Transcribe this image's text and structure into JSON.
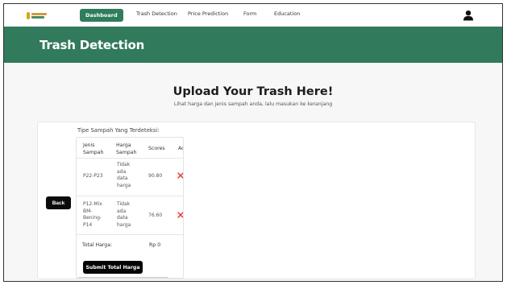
{
  "nav": {
    "items": [
      {
        "label": "Dashboard",
        "active": true
      },
      {
        "label": "Trash Detection",
        "active": false
      },
      {
        "label": "Price Prediction",
        "active": false
      },
      {
        "label": "Form",
        "active": false
      },
      {
        "label": "Education",
        "active": false
      }
    ]
  },
  "header": {
    "title": "Trash Detection"
  },
  "upload": {
    "title": "Upload Your Trash Here!",
    "subtitle": "Lihat harga dan jenis sampah anda, lalu masukan ke keranjang"
  },
  "back_label": "Back",
  "detected_label": "Tipe Sampah Yang Terdeteksi:",
  "table": {
    "headers": [
      "Jenis Sampah",
      "Harga Sampah",
      "Scores",
      "Ac"
    ],
    "rows": [
      {
        "jenis": "P22-P23",
        "harga": "Tidak ada data harga",
        "score": "90.80"
      },
      {
        "jenis": "P12-Mix BM-Bening-P14",
        "harga": "Tidak ada data harga",
        "score": "76.60"
      }
    ],
    "total_label": "Total Harga:",
    "total_value": "Rp 0"
  },
  "submit_label": "Submit Total Harga",
  "colors": {
    "brand_green": "#317a5b",
    "delete_red": "#e53935"
  },
  "icons": {
    "user": "user-icon",
    "delete": "close-icon"
  }
}
